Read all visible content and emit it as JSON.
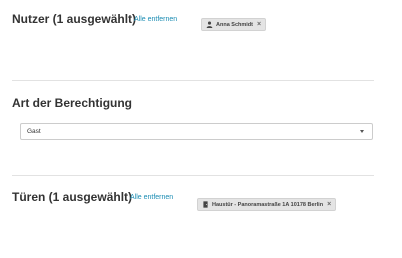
{
  "users": {
    "title": "Nutzer (1 ausgewählt)",
    "remove_all": "Alle entfernen",
    "chip": {
      "label": "Anna Schmidt",
      "icon": "user-icon",
      "remove": "×"
    }
  },
  "permission": {
    "title": "Art der Berechtigung",
    "selected": "Gast",
    "icon": "chevron-down-icon"
  },
  "doors": {
    "title": "Türen (1 ausgewählt)",
    "remove_all": "Alle entfernen",
    "chip": {
      "label": "Haustür - Panoramastraße 1A 10178 Berlin",
      "icon": "door-icon",
      "remove": "×"
    }
  },
  "colors": {
    "link": "#1a8cb3",
    "chip_bg": "#e4e4e4",
    "divider": "#e2e2e2"
  }
}
